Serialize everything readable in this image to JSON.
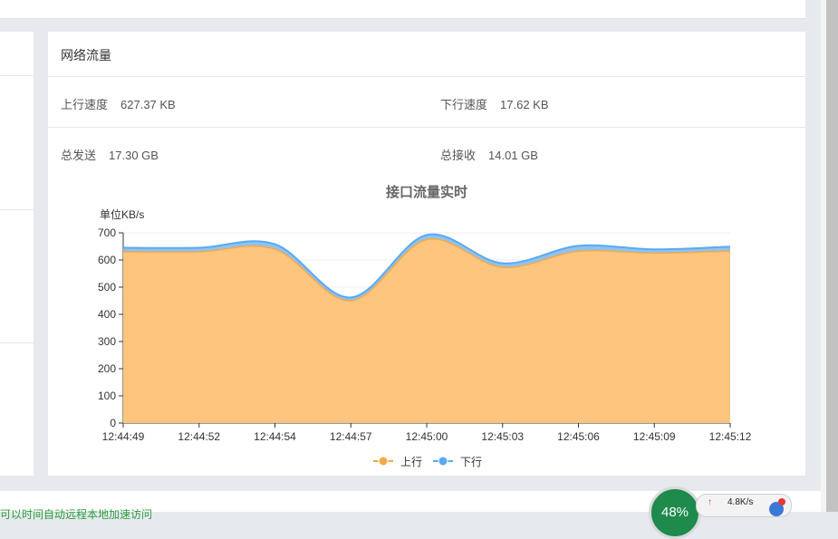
{
  "panel": {
    "title": "网络流量"
  },
  "stats": {
    "upload_speed_label": "上行速度",
    "upload_speed_value": "627.37 KB",
    "download_speed_label": "下行速度",
    "download_speed_value": "17.62 KB",
    "total_sent_label": "总发送",
    "total_sent_value": "17.30 GB",
    "total_received_label": "总接收",
    "total_received_value": "14.01 GB"
  },
  "chart_data": {
    "type": "area",
    "title": "接口流量实时",
    "ylabel": "单位KB/s",
    "ylim": [
      0,
      700
    ],
    "yticks": [
      0,
      100,
      200,
      300,
      400,
      500,
      600,
      700
    ],
    "x": [
      "12:44:49",
      "12:44:52",
      "12:44:54",
      "12:44:57",
      "12:45:00",
      "12:45:03",
      "12:45:06",
      "12:45:09",
      "12:45:12"
    ],
    "series": [
      {
        "name": "上行",
        "color": "#fbc277",
        "values": [
          630,
          630,
          640,
          450,
          675,
          573,
          632,
          625,
          633
        ]
      },
      {
        "name": "下行",
        "color": "#5aa9f2",
        "values": [
          15,
          15,
          18,
          12,
          17,
          15,
          20,
          14,
          16
        ]
      }
    ],
    "stacked": true,
    "legend_position": "bottom-center",
    "grid": true
  },
  "tray": {
    "percent": "48%",
    "speed": "4.8K/s",
    "arrow": "↑"
  },
  "footer": {
    "link_text": "可以时间自动远程本地加速访问"
  }
}
